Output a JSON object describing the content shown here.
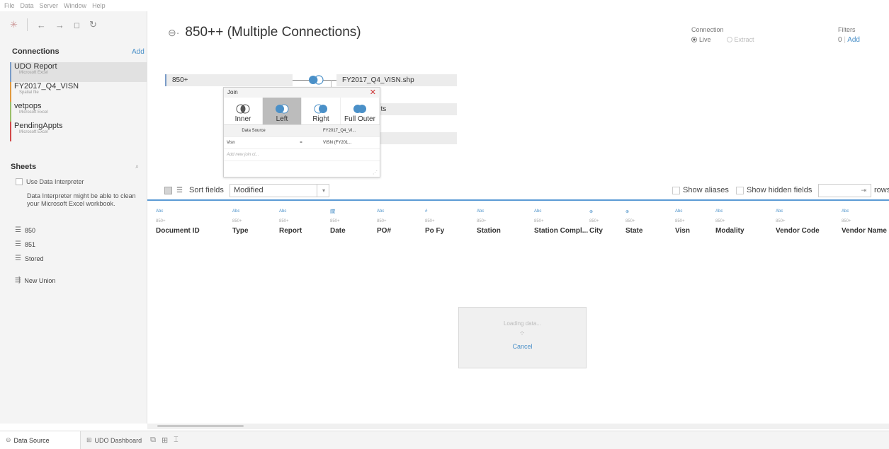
{
  "menu": [
    "File",
    "Data",
    "Server",
    "Window",
    "Help"
  ],
  "toolbar_icons": [
    "tableau-logo-icon",
    "back-icon",
    "forward-icon",
    "save-icon",
    "refresh-icon"
  ],
  "connections": {
    "title": "Connections",
    "add": "Add",
    "items": [
      {
        "name": "UDO Report",
        "type": "Microsoft Excel",
        "color": "#7a9cc8"
      },
      {
        "name": "FY2017_Q4_VISN",
        "type": "Spatial file",
        "color": "#e09a40"
      },
      {
        "name": "vetpops",
        "type": "Microsoft Excel",
        "color": "#9bbf6a"
      },
      {
        "name": "PendingAppts",
        "type": "Microsoft Excel",
        "color": "#d24a4a"
      }
    ]
  },
  "sheets": {
    "title": "Sheets",
    "search_icon": "search-icon",
    "interpreter_label": "Use Data Interpreter",
    "interpreter_note": "Data Interpreter might be able to clean your Microsoft Excel workbook.",
    "items": [
      "850",
      "851",
      "Stored"
    ],
    "new_union": "New Union"
  },
  "header": {
    "title": "850++ (Multiple Connections)",
    "connection_label": "Connection",
    "live": "Live",
    "extract": "Extract",
    "filters_label": "Filters",
    "filters_count": "0",
    "filters_sep": "|",
    "filters_add": "Add"
  },
  "canvas": {
    "left_table": "850+",
    "right_table": "FY2017_Q4_VISN.shp",
    "pending_table": "PendingAppts"
  },
  "join_dialog": {
    "title": "Join",
    "types": [
      "Inner",
      "Left",
      "Right",
      "Full Outer"
    ],
    "selected": "Left",
    "col_left_header": "Data Source",
    "col_right_header": "FY2017_Q4_VI...",
    "clause_left": "Visn",
    "clause_op": "=",
    "clause_right": "VISN (FY201...",
    "add_clause": "Add new join cl..."
  },
  "grid": {
    "sort_label": "Sort fields",
    "sort_value": "Modified",
    "show_aliases": "Show aliases",
    "show_hidden": "Show hidden fields",
    "rows_label": "rows",
    "rows_arrow": "⇥",
    "columns": [
      {
        "type": "Abc",
        "source": "850+",
        "name": "Document ID"
      },
      {
        "type": "Abc",
        "source": "850+",
        "name": "Type"
      },
      {
        "type": "Abc",
        "source": "850+",
        "name": "Report"
      },
      {
        "type": "calendar",
        "source": "850+",
        "name": "Date"
      },
      {
        "type": "Abc",
        "source": "850+",
        "name": "PO#"
      },
      {
        "type": "#",
        "source": "850+",
        "name": "Po Fy"
      },
      {
        "type": "Abc",
        "source": "850+",
        "name": "Station"
      },
      {
        "type": "Abc",
        "source": "850+",
        "name": "Station Compl..."
      },
      {
        "type": "globe",
        "source": "850+",
        "name": "City"
      },
      {
        "type": "globe",
        "source": "850+",
        "name": "State"
      },
      {
        "type": "Abc",
        "source": "850+",
        "name": "Visn"
      },
      {
        "type": "Abc",
        "source": "850+",
        "name": "Modality"
      },
      {
        "type": "Abc",
        "source": "850+",
        "name": "Vendor Code"
      },
      {
        "type": "Abc",
        "source": "850+",
        "name": "Vendor Name"
      }
    ]
  },
  "loading": {
    "text": "Loading data...",
    "cancel": "Cancel"
  },
  "tabs": [
    {
      "label": "Data Source",
      "active": true
    },
    {
      "label": "UDO Dashboard",
      "active": false
    }
  ],
  "tab_icons": [
    "new-worksheet-icon",
    "new-dashboard-icon",
    "new-story-icon"
  ],
  "colors": {
    "accent": "#4a90c8",
    "tab_rule": "#5b9bd5",
    "join_selected": "#bcbcbc"
  }
}
